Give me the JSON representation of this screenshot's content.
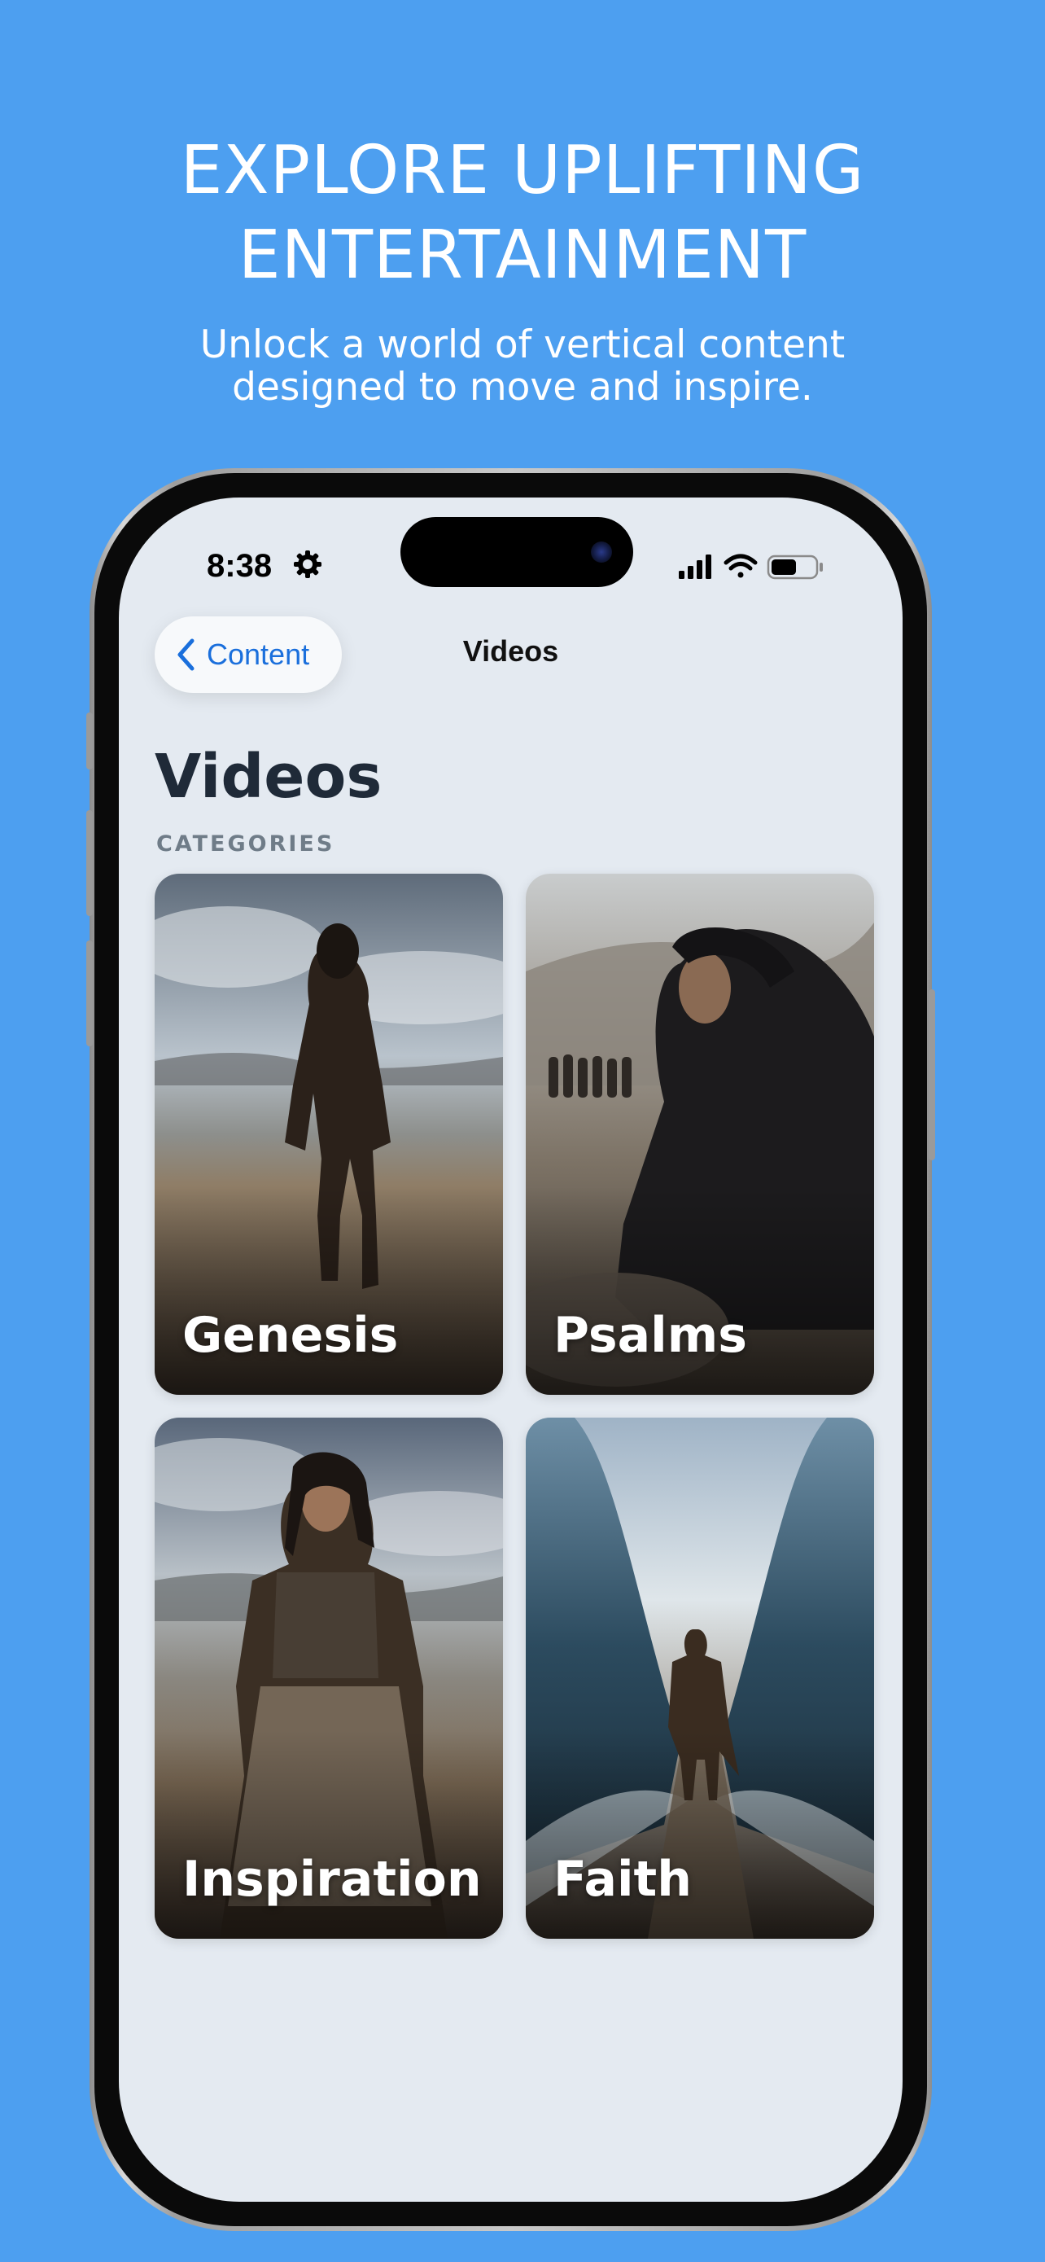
{
  "promo": {
    "headline_line1": "EXPLORE UPLIFTING",
    "headline_line2": "ENTERTAINMENT",
    "subtitle_line1": "Unlock a world of vertical content",
    "subtitle_line2": "designed to move and inspire."
  },
  "status_bar": {
    "time": "8:38",
    "icons": [
      "gear-icon",
      "signal-icon",
      "wifi-icon",
      "battery-icon"
    ]
  },
  "nav": {
    "back_label": "Content",
    "title": "Videos"
  },
  "page": {
    "title": "Videos",
    "section_label": "CATEGORIES"
  },
  "categories": [
    {
      "label": "Genesis"
    },
    {
      "label": "Psalms"
    },
    {
      "label": "Inspiration"
    },
    {
      "label": "Faith"
    }
  ],
  "colors": {
    "background": "#4d9ff0",
    "screen": "#e4eaf1",
    "accent": "#1a6fdc"
  }
}
